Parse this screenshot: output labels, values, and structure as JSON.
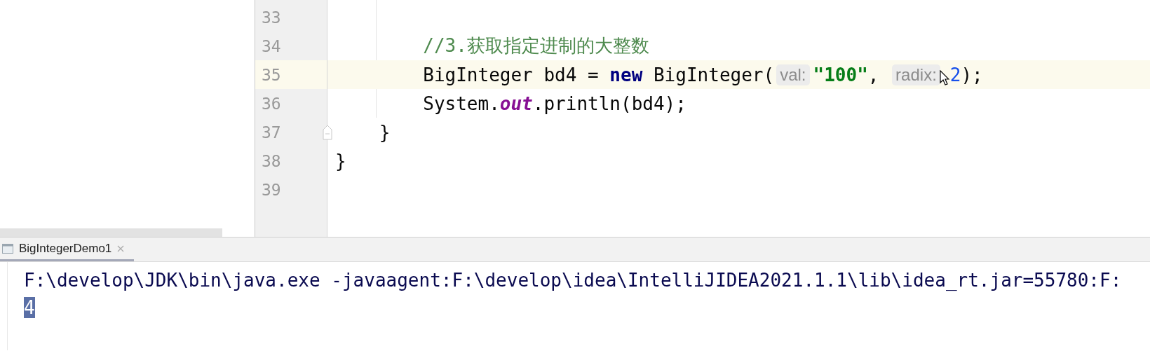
{
  "editor": {
    "lines": [
      {
        "number": "33",
        "current": false,
        "fold": false
      },
      {
        "number": "34",
        "current": false,
        "fold": false,
        "tokens": [
          {
            "kind": "comment",
            "text": "        //3.获取指定进制的大整数"
          }
        ]
      },
      {
        "number": "35",
        "current": true,
        "fold": false,
        "tokens": [
          {
            "kind": "plain",
            "text": "        BigInteger bd4 = "
          },
          {
            "kind": "keyword",
            "text": "new"
          },
          {
            "kind": "plain",
            "text": " BigInteger("
          },
          {
            "kind": "hint",
            "text": "val:"
          },
          {
            "kind": "string",
            "text": "\"100\""
          },
          {
            "kind": "plain",
            "text": ", "
          },
          {
            "kind": "hint",
            "text": "radix:"
          },
          {
            "kind": "number",
            "text": "2"
          },
          {
            "kind": "plain",
            "text": ");"
          }
        ]
      },
      {
        "number": "36",
        "current": false,
        "fold": false,
        "tokens": [
          {
            "kind": "plain",
            "text": "        System."
          },
          {
            "kind": "static",
            "text": "out"
          },
          {
            "kind": "plain",
            "text": ".println(bd4);"
          }
        ]
      },
      {
        "number": "37",
        "current": false,
        "fold": true,
        "tokens": [
          {
            "kind": "plain",
            "text": "    }"
          }
        ]
      },
      {
        "number": "38",
        "current": false,
        "fold": false,
        "tokens": [
          {
            "kind": "plain",
            "text": "}"
          }
        ]
      },
      {
        "number": "39",
        "current": false,
        "fold": false
      }
    ]
  },
  "console": {
    "tabs": [
      {
        "label": "BigIntegerDemo1",
        "selected": true
      }
    ],
    "output": [
      {
        "text": "F:\\develop\\JDK\\bin\\java.exe -javaagent:F:\\develop\\idea\\IntelliJIDEA2021.1.1\\lib\\idea_rt.jar=55780:F:",
        "selected": false
      },
      {
        "text": "4",
        "selected": true
      }
    ]
  }
}
